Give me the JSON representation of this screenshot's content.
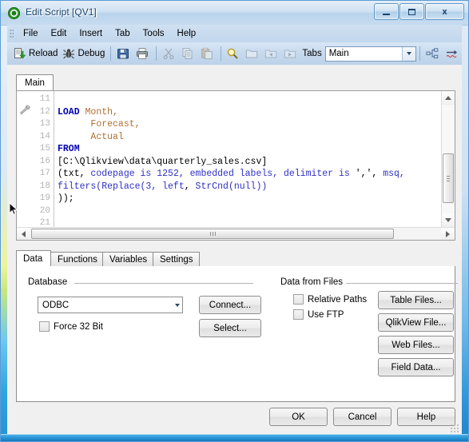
{
  "window": {
    "title": "Edit Script [QV1]",
    "icon": "qlikview-logo-icon",
    "minimize_label": "",
    "maximize_label": "",
    "close_label": "x"
  },
  "menubar": {
    "items": [
      {
        "label": "File"
      },
      {
        "label": "Edit"
      },
      {
        "label": "Insert"
      },
      {
        "label": "Tab"
      },
      {
        "label": "Tools"
      },
      {
        "label": "Help"
      }
    ]
  },
  "toolbar": {
    "reload_label": "Reload",
    "debug_label": "Debug",
    "save_label": "",
    "print_label": "",
    "cut_label": "",
    "copy_label": "",
    "paste_label": "",
    "find_label": "",
    "open_label": "",
    "back_label": "",
    "forward_label": "",
    "tabs_label": "Tabs",
    "tabs_value": "Main",
    "tabs_options": [
      "Main"
    ],
    "structure_label": "",
    "syntax_label": ""
  },
  "script": {
    "tabs": [
      {
        "label": "Main",
        "active": true
      }
    ],
    "gutter_icon": "wrench-icon",
    "line_numbers": [
      "11",
      "12",
      "13",
      "14",
      "15",
      "16",
      "17",
      "18",
      "19",
      "20",
      "21"
    ],
    "lines": [
      {
        "n": "11",
        "tokens": []
      },
      {
        "n": "12",
        "tokens": [
          {
            "t": "LOAD",
            "c": "kw"
          },
          {
            "t": " ",
            "c": "plain"
          },
          {
            "t": "Month,",
            "c": "fld"
          }
        ]
      },
      {
        "n": "13",
        "tokens": [
          {
            "t": "      ",
            "c": "plain"
          },
          {
            "t": "Forecast,",
            "c": "fld"
          }
        ]
      },
      {
        "n": "14",
        "tokens": [
          {
            "t": "      ",
            "c": "plain"
          },
          {
            "t": "Actual",
            "c": "fld"
          }
        ]
      },
      {
        "n": "15",
        "tokens": [
          {
            "t": "FROM",
            "c": "kw"
          }
        ]
      },
      {
        "n": "16",
        "tokens": [
          {
            "t": "[C:\\Qlikview\\data\\quarterly_sales.csv]",
            "c": "plain"
          }
        ]
      },
      {
        "n": "17",
        "tokens": [
          {
            "t": "(txt, ",
            "c": "plain"
          },
          {
            "t": "codepage is 1252, embedded labels, delimiter is ",
            "c": "fn"
          },
          {
            "t": "',', ",
            "c": "plain"
          },
          {
            "t": "msq,",
            "c": "fn"
          }
        ]
      },
      {
        "n": "18",
        "tokens": [
          {
            "t": "filters(Replace(3, ",
            "c": "fn"
          },
          {
            "t": "left",
            "c": "fn"
          },
          {
            "t": ", ",
            "c": "plain"
          },
          {
            "t": "StrCnd(null))",
            "c": "fn"
          }
        ]
      },
      {
        "n": "19",
        "tokens": [
          {
            "t": "));",
            "c": "plain"
          }
        ]
      },
      {
        "n": "20",
        "tokens": []
      },
      {
        "n": "21",
        "tokens": []
      }
    ],
    "full_text": "LOAD Month,\n      Forecast,\n      Actual\nFROM\n[C:\\Qlikview\\data\\quarterly_sales.csv]\n(txt, codepage is 1252, embedded labels, delimiter is ',', msq,\nfilters(Replace(3, left, StrCnd(null))\n));",
    "vscroll_name": "editor-vertical-scrollbar",
    "hscroll_name": "editor-horizontal-scrollbar"
  },
  "lower_tabs": [
    {
      "label": "Data",
      "active": true
    },
    {
      "label": "Functions",
      "active": false
    },
    {
      "label": "Variables",
      "active": false
    },
    {
      "label": "Settings",
      "active": false
    }
  ],
  "data_tab": {
    "database_group": {
      "label": "Database",
      "combo_value": "ODBC",
      "combo_options": [
        "ODBC"
      ],
      "connect_button": "Connect...",
      "select_button": "Select...",
      "force32_label": "Force 32 Bit",
      "force32_checked": false
    },
    "files_group": {
      "label": "Data from Files",
      "relative_paths_label": "Relative Paths",
      "relative_paths_checked": false,
      "use_ftp_label": "Use FTP",
      "use_ftp_checked": false,
      "buttons": [
        {
          "label": "Table Files..."
        },
        {
          "label": "QlikView File..."
        },
        {
          "label": "Web Files..."
        },
        {
          "label": "Field Data..."
        }
      ]
    }
  },
  "dialog_buttons": [
    {
      "label": "OK"
    },
    {
      "label": "Cancel"
    },
    {
      "label": "Help"
    }
  ],
  "colors": {
    "keyword": "#0000b0",
    "field": "#b07030",
    "function": "#3030c8",
    "title_text": "#16436e",
    "frame_accent": "#2d9ada"
  }
}
